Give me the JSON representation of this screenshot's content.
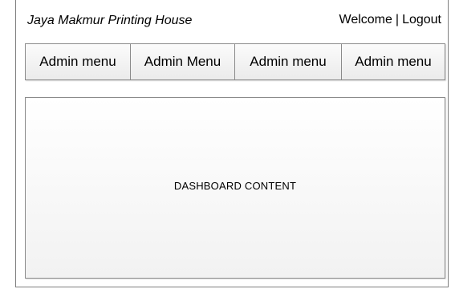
{
  "header": {
    "brand": "Jaya Makmur Printing House",
    "welcome": "Welcome",
    "separator": "|",
    "logout": "Logout"
  },
  "menu": {
    "items": [
      {
        "label": "Admin menu"
      },
      {
        "label": "Admin Menu"
      },
      {
        "label": "Admin menu"
      },
      {
        "label": "Admin menu"
      }
    ]
  },
  "main": {
    "content_label": "DASHBOARD CONTENT"
  },
  "colors": {
    "border": "#8a8a8a",
    "menu_bg": "#f2f2f2",
    "text": "#000000"
  }
}
